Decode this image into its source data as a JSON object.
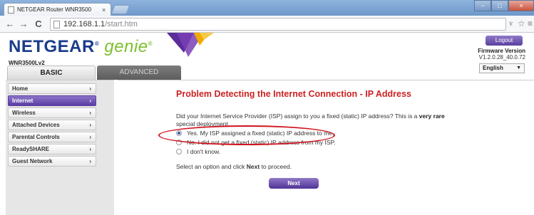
{
  "browser": {
    "tab_title": "NETGEAR Router WNR3500",
    "tab_close": "×",
    "url_host": "192.168.1.1",
    "url_path": "/start.htm",
    "back": "←",
    "forward": "→",
    "reload": "C",
    "extension_icon": "♆",
    "bookmark_star": "☆",
    "menu_icon": "≡",
    "window_minimize": "−",
    "window_maximize": "□",
    "window_close": "×"
  },
  "header": {
    "brand": "NETGEAR",
    "brand_mark": "®",
    "product": "genie",
    "product_mark": "®",
    "model": "WNR3500Lv2",
    "logout_label": "Logout",
    "firmware_label": "Firmware Version",
    "firmware_value": "V1.2.0.28_40.0.72",
    "language": "English",
    "language_caret": "▼"
  },
  "tabs": {
    "basic": "BASIC",
    "advanced": "ADVANCED"
  },
  "sidebar": {
    "chevron": "›",
    "items": [
      {
        "label": "Home"
      },
      {
        "label": "Internet"
      },
      {
        "label": "Wireless"
      },
      {
        "label": "Attached Devices"
      },
      {
        "label": "Parental Controls"
      },
      {
        "label": "ReadySHARE"
      },
      {
        "label": "Guest Network"
      }
    ]
  },
  "main": {
    "title": "Problem Detecting the Internet Connection - IP Address",
    "question_pre": "Did your Internet Service Provider (ISP) assign to you a fixed (static) IP address? This is a ",
    "question_bold": "very rare",
    "question_post": " special deployment.",
    "options": [
      {
        "label": "Yes. My ISP assigned a fixed (static) IP address to me.",
        "checked": true
      },
      {
        "label": "No. I did not get a fixed (static) IP address from my ISP.",
        "checked": false
      },
      {
        "label": "I don't know.",
        "checked": false
      }
    ],
    "instruction_pre": "Select an option and click ",
    "instruction_bold": "Next",
    "instruction_post": " to proceed.",
    "next_label": "Next"
  },
  "colors": {
    "brand_blue": "#1a3c8a",
    "genie_green": "#7cbf2c",
    "accent_purple": "#5b3ea3",
    "title_red": "#cc2222",
    "highlight_red": "#d0141e"
  }
}
